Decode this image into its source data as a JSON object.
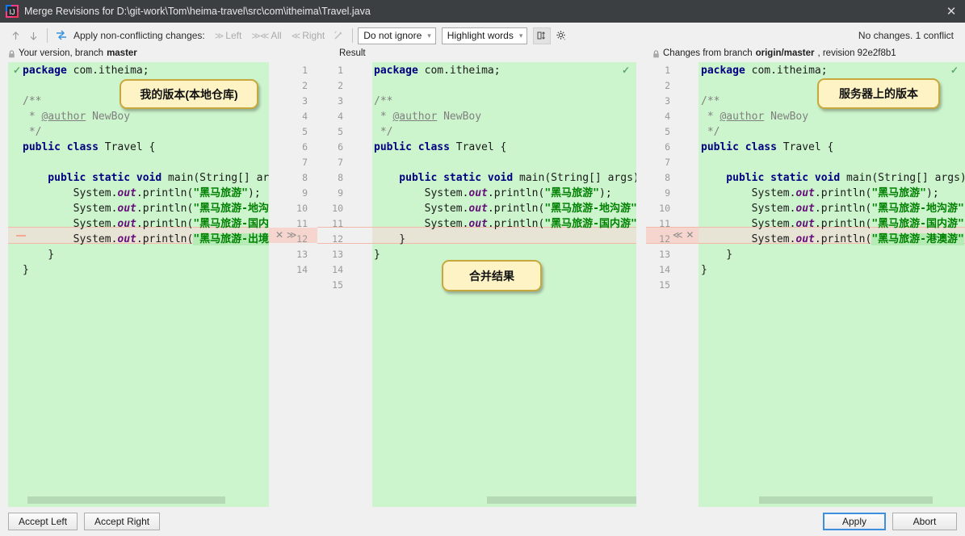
{
  "window": {
    "title": "Merge Revisions for D:\\git-work\\Tom\\heima-travel\\src\\com\\itheima\\Travel.java",
    "app_icon": "intellij-idea-icon",
    "close_label": "✕"
  },
  "toolbar": {
    "prev_icon": "arrow-up-icon",
    "next_icon": "arrow-down-icon",
    "apply_all_icon": "apply-non-conflicting-icon",
    "apply_label": "Apply non-conflicting changes:",
    "actions": [
      {
        "label": "Left",
        "icon": "chevron-right-double-icon",
        "glyph": "≫"
      },
      {
        "label": "All",
        "icon": "apply-all-icon",
        "glyph": "≫≪"
      },
      {
        "label": "Right",
        "icon": "chevron-left-double-icon",
        "glyph": "≪"
      }
    ],
    "magic_icon": "magic-wand-icon",
    "ignore_select": {
      "value": "Do not ignore",
      "arrow": "⌄"
    },
    "highlight_select": {
      "value": "Highlight words",
      "arrow": "⌄"
    },
    "columns_toggle_icon": "side-by-side-viewer-icon",
    "settings_icon": "gear-icon",
    "status": "No changes. 1 conflict"
  },
  "headers": {
    "left": {
      "lock_icon": "lock-icon",
      "prefix": "Your version, branch ",
      "strong": "master"
    },
    "center": {
      "title": "Result"
    },
    "right": {
      "lock_icon": "lock-icon",
      "prefix": "Changes from branch ",
      "strong": "origin/master",
      "suffix": ", revision 92e2f8b1"
    }
  },
  "callouts": [
    {
      "text": "我的版本(本地仓库)",
      "name": "callout-local-version"
    },
    {
      "text": "合并结果",
      "name": "callout-merge-result"
    },
    {
      "text": "服务器上的版本",
      "name": "callout-server-version"
    }
  ],
  "panes": {
    "left": {
      "name": "left-pane",
      "check_icon": "checkmark-icon",
      "line_count": 13,
      "conflict_line_index": 11,
      "lines": [
        [
          {
            "t": "package ",
            "c": "kw"
          },
          {
            "t": "com.itheima;",
            "c": "plain"
          }
        ],
        [],
        [
          {
            "t": "/**",
            "c": "cmt"
          }
        ],
        [
          {
            "t": " * ",
            "c": "cmt"
          },
          {
            "t": "@author",
            "c": "tag"
          },
          {
            "t": " NewBoy",
            "c": "cmt"
          }
        ],
        [
          {
            "t": " */",
            "c": "cmt"
          }
        ],
        [
          {
            "t": "public class ",
            "c": "kw"
          },
          {
            "t": "Travel {",
            "c": "plain"
          }
        ],
        [],
        [
          {
            "t": "    public static void ",
            "c": "kw"
          },
          {
            "t": "main(String[] args) {",
            "c": "plain"
          }
        ],
        [
          {
            "t": "        System.",
            "c": "plain"
          },
          {
            "t": "out",
            "c": "fld"
          },
          {
            "t": ".println(",
            "c": "plain"
          },
          {
            "t": "\"黑马旅游\"",
            "c": "str"
          },
          {
            "t": ");",
            "c": "plain"
          }
        ],
        [
          {
            "t": "        System.",
            "c": "plain"
          },
          {
            "t": "out",
            "c": "fld"
          },
          {
            "t": ".println(",
            "c": "plain"
          },
          {
            "t": "\"黑马旅游-地沟游\"",
            "c": "str"
          },
          {
            "t": ");",
            "c": "plain"
          }
        ],
        [
          {
            "t": "        System.",
            "c": "plain"
          },
          {
            "t": "out",
            "c": "fld"
          },
          {
            "t": ".println(",
            "c": "plain"
          },
          {
            "t": "\"黑马旅游-国内游\"",
            "c": "str"
          },
          {
            "t": ");",
            "c": "plain"
          }
        ],
        [
          {
            "t": "        System.",
            "c": "plain"
          },
          {
            "t": "out",
            "c": "fld"
          },
          {
            "t": ".println(",
            "c": "plain"
          },
          {
            "t": "\"黑马旅游-出境游\"",
            "c": "strhl"
          },
          {
            "t": ");",
            "c": "plain"
          }
        ],
        [
          {
            "t": "    }",
            "c": "plain"
          }
        ],
        [
          {
            "t": "}",
            "c": "plain"
          }
        ]
      ]
    },
    "center": {
      "name": "result-pane",
      "check_icon": "checkmark-icon",
      "gutter_left_numbers": [
        "1",
        "2",
        "3",
        "4",
        "5",
        "6",
        "7",
        "8",
        "9",
        "10",
        "11",
        "12",
        "13",
        "14"
      ],
      "gutter_right_numbers": [
        "1",
        "2",
        "3",
        "4",
        "5",
        "6",
        "7",
        "8",
        "9",
        "10",
        "11",
        "12",
        "13",
        "14",
        "15"
      ],
      "conflict_line_index": 11,
      "conflict_marks": "✕ ≫",
      "lines": [
        [
          {
            "t": "package ",
            "c": "kw"
          },
          {
            "t": "com.itheima;",
            "c": "plain"
          }
        ],
        [],
        [
          {
            "t": "/**",
            "c": "cmt"
          }
        ],
        [
          {
            "t": " * ",
            "c": "cmt"
          },
          {
            "t": "@author",
            "c": "tag"
          },
          {
            "t": " NewBoy",
            "c": "cmt"
          }
        ],
        [
          {
            "t": " */",
            "c": "cmt"
          }
        ],
        [
          {
            "t": "public class ",
            "c": "kw"
          },
          {
            "t": "Travel {",
            "c": "plain"
          }
        ],
        [],
        [
          {
            "t": "    public static void ",
            "c": "kw"
          },
          {
            "t": "main(String[] args) {",
            "c": "plain"
          }
        ],
        [
          {
            "t": "        System.",
            "c": "plain"
          },
          {
            "t": "out",
            "c": "fld"
          },
          {
            "t": ".println(",
            "c": "plain"
          },
          {
            "t": "\"黑马旅游\"",
            "c": "str"
          },
          {
            "t": ");",
            "c": "plain"
          }
        ],
        [
          {
            "t": "        System.",
            "c": "plain"
          },
          {
            "t": "out",
            "c": "fld"
          },
          {
            "t": ".println(",
            "c": "plain"
          },
          {
            "t": "\"黑马旅游-地沟游\"",
            "c": "str"
          },
          {
            "t": ");",
            "c": "plain"
          }
        ],
        [
          {
            "t": "        System.",
            "c": "plain"
          },
          {
            "t": "out",
            "c": "fld"
          },
          {
            "t": ".println(",
            "c": "plain"
          },
          {
            "t": "\"黑马旅游-国内游\"",
            "c": "str"
          },
          {
            "t": ");",
            "c": "plain"
          }
        ],
        [
          {
            "t": "    }",
            "c": "plain"
          }
        ],
        [
          {
            "t": "}",
            "c": "plain"
          }
        ]
      ]
    },
    "right": {
      "name": "right-pane",
      "check_icon": "checkmark-icon",
      "line_count": 15,
      "conflict_line_index": 11,
      "conflict_marks": "≪ ✕",
      "gutter_numbers": [
        "1",
        "2",
        "3",
        "4",
        "5",
        "6",
        "7",
        "8",
        "9",
        "10",
        "11",
        "12",
        "13",
        "14",
        "15"
      ],
      "lines": [
        [
          {
            "t": "package ",
            "c": "kw"
          },
          {
            "t": "com.itheima;",
            "c": "plain"
          }
        ],
        [],
        [
          {
            "t": "/**",
            "c": "cmt"
          }
        ],
        [
          {
            "t": " * ",
            "c": "cmt"
          },
          {
            "t": "@author",
            "c": "tag"
          },
          {
            "t": " NewBoy",
            "c": "cmt"
          }
        ],
        [
          {
            "t": " */",
            "c": "cmt"
          }
        ],
        [
          {
            "t": "public class ",
            "c": "kw"
          },
          {
            "t": "Travel {",
            "c": "plain"
          }
        ],
        [],
        [
          {
            "t": "    public static void ",
            "c": "kw"
          },
          {
            "t": "main(String[] args) {",
            "c": "plain"
          }
        ],
        [
          {
            "t": "        System.",
            "c": "plain"
          },
          {
            "t": "out",
            "c": "fld"
          },
          {
            "t": ".println(",
            "c": "plain"
          },
          {
            "t": "\"黑马旅游\"",
            "c": "str"
          },
          {
            "t": ");",
            "c": "plain"
          }
        ],
        [
          {
            "t": "        System.",
            "c": "plain"
          },
          {
            "t": "out",
            "c": "fld"
          },
          {
            "t": ".println(",
            "c": "plain"
          },
          {
            "t": "\"黑马旅游-地沟游\"",
            "c": "str"
          },
          {
            "t": ");",
            "c": "plain"
          }
        ],
        [
          {
            "t": "        System.",
            "c": "plain"
          },
          {
            "t": "out",
            "c": "fld"
          },
          {
            "t": ".println(",
            "c": "plain"
          },
          {
            "t": "\"黑马旅游-国内游\"",
            "c": "str"
          },
          {
            "t": ");",
            "c": "plain"
          }
        ],
        [
          {
            "t": "        System.",
            "c": "plain"
          },
          {
            "t": "out",
            "c": "fld"
          },
          {
            "t": ".println(",
            "c": "plain"
          },
          {
            "t": "\"黑马旅游-港澳游\"",
            "c": "strhl"
          },
          {
            "t": ");",
            "c": "plain"
          }
        ],
        [
          {
            "t": "    }",
            "c": "plain"
          }
        ],
        [
          {
            "t": "}",
            "c": "plain"
          }
        ]
      ]
    }
  },
  "footer": {
    "accept_left": "Accept Left",
    "accept_right": "Accept Right",
    "apply": "Apply",
    "abort": "Abort"
  },
  "colors": {
    "code_background": "#cdf5cd",
    "conflict_row": "#e8e4d5",
    "conflict_gutter": "#f5d5cd",
    "titlebar": "#3c3f41",
    "accent": "#3e8ede",
    "callout_fill": "#fdf3c5",
    "callout_border": "#c8a83c"
  }
}
